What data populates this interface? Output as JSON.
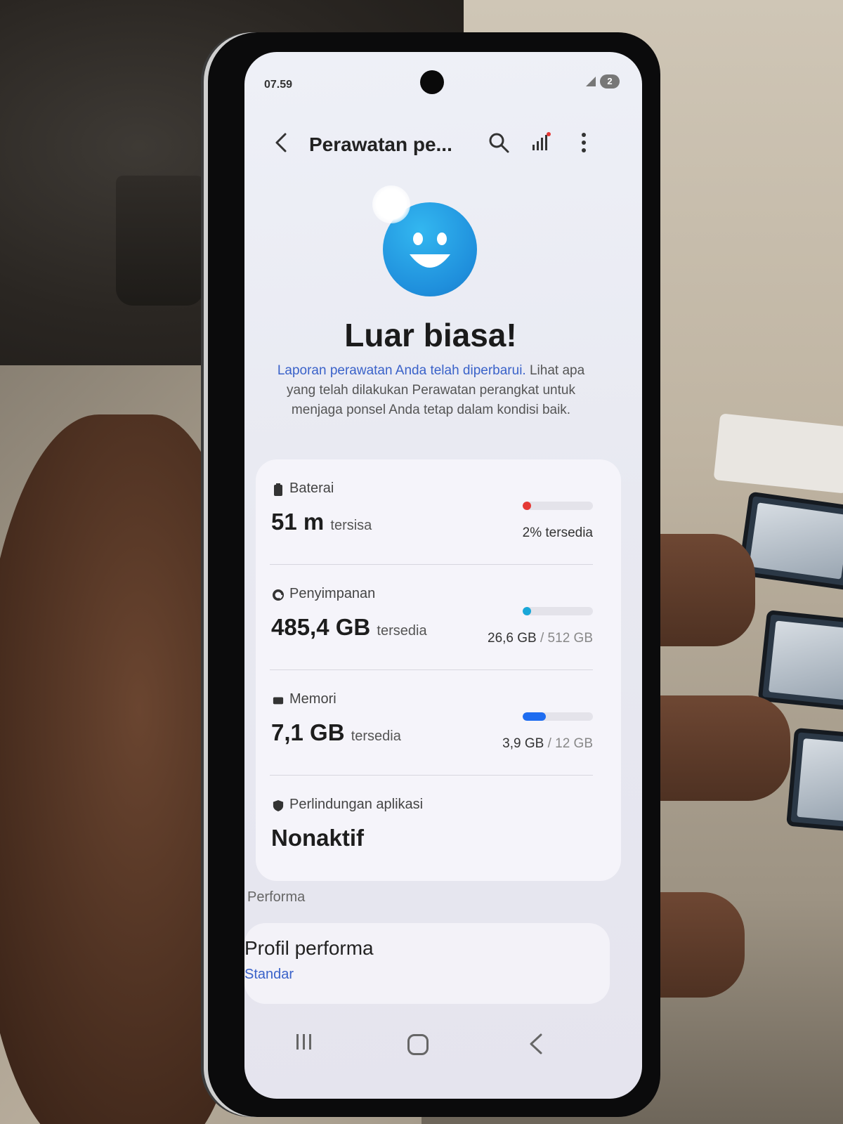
{
  "status_bar": {
    "time": "07.59",
    "notification_count": "2"
  },
  "app_bar": {
    "title": "Perawatan pe..."
  },
  "hero": {
    "headline": "Luar biasa!",
    "description_link": "Laporan perawatan Anda telah diperbarui.",
    "description_rest": " Lihat apa yang telah dilakukan Perawatan perangkat untuk menjaga ponsel Anda tetap dalam kondisi baik."
  },
  "cards": {
    "battery": {
      "label": "Baterai",
      "value": "51 m",
      "value_suffix": "tersisa",
      "stat": "2% tersedia",
      "fraction": 0.02,
      "color": "#e53935"
    },
    "storage": {
      "label": "Penyimpanan",
      "value": "485,4 GB",
      "value_suffix": "tersedia",
      "stat_used": "26,6 GB",
      "stat_total": "/ 512 GB",
      "fraction": 0.052,
      "color": "#19a7d8"
    },
    "memory": {
      "label": "Memori",
      "value": "7,1 GB",
      "value_suffix": "tersedia",
      "stat_used": "3,9 GB",
      "stat_total": "/ 12 GB",
      "fraction": 0.325,
      "color": "#1e6cf0"
    },
    "app_protection": {
      "label": "Perlindungan aplikasi",
      "value": "Nonaktif"
    }
  },
  "performance": {
    "section_title": "Performa",
    "profile_title": "Profil performa",
    "profile_value": "Standar"
  },
  "colors": {
    "accent": "#3a62c9",
    "smiley": "#1f8fdc"
  }
}
